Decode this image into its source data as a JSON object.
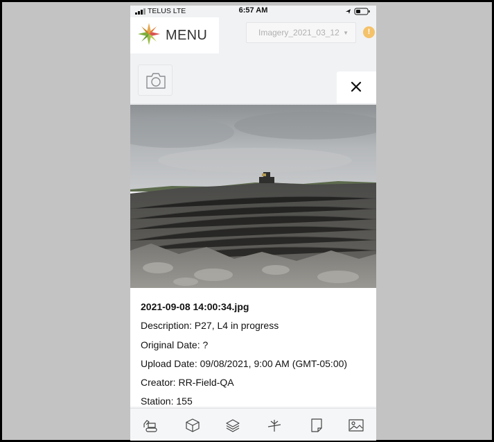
{
  "status_bar": {
    "carrier": "TELUS  LTE",
    "time": "6:57 AM"
  },
  "header": {
    "menu_label": "MENU",
    "imagery_select": "Imagery_2021_03_12",
    "alert_symbol": "!"
  },
  "photo_details": {
    "filename": "2021-09-08 14:00:34.jpg",
    "description": "Description: P27, L4 in progress",
    "original_date": "Original Date: ?",
    "upload_date": "Upload Date: 09/08/2021, 9:00 AM (GMT-05:00)",
    "creator": "Creator: RR-Field-QA",
    "station": "Station: 155"
  },
  "icons": {
    "camera": "camera-icon",
    "close": "close-icon",
    "alert": "alert-icon",
    "toolbar": [
      "excavator-icon",
      "cube-icon",
      "layers-icon",
      "measure-icon",
      "note-icon",
      "image-icon"
    ]
  },
  "colors": {
    "accent_alert": "#f4c26a",
    "frame_background": "#c3c3c3",
    "app_background": "#f1f2f4"
  }
}
